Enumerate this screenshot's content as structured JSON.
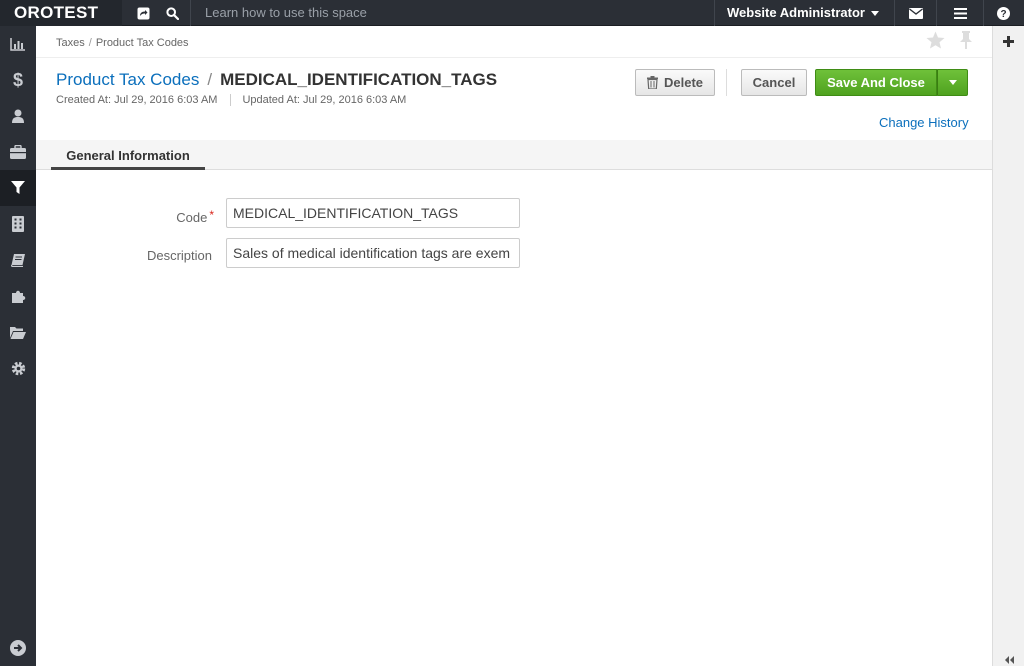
{
  "topbar": {
    "logo": "OROTEST",
    "search_hint": "Learn how to use this space",
    "user_name": "Website Administrator",
    "icons": [
      "share-icon",
      "search-icon",
      "envelope-icon",
      "menu-icon",
      "help-icon"
    ]
  },
  "sidebar": {
    "items": [
      {
        "icon": "dashboard-chart-icon"
      },
      {
        "icon": "dollar-icon"
      },
      {
        "icon": "user-icon"
      },
      {
        "icon": "briefcase-icon"
      },
      {
        "icon": "filter-icon",
        "active": true
      },
      {
        "icon": "building-icon"
      },
      {
        "icon": "book-icon"
      },
      {
        "icon": "puzzle-icon"
      },
      {
        "icon": "folder-open-icon"
      },
      {
        "icon": "gear-icon"
      }
    ],
    "bottom_icon": "arrow-right-circle-icon"
  },
  "breadcrumb": {
    "parent": "Taxes",
    "current": "Product Tax Codes"
  },
  "header": {
    "entity_type": "Product Tax Codes",
    "separator": "/",
    "entity_name": "MEDICAL_IDENTIFICATION_TAGS",
    "created_at": "Created At: Jul 29, 2016 6:03 AM",
    "updated_at": "Updated At: Jul 29, 2016 6:03 AM"
  },
  "actions": {
    "delete_label": "Delete",
    "cancel_label": "Cancel",
    "save_label": "Save And Close",
    "change_history_label": "Change History"
  },
  "tabs": [
    {
      "label": "General Information",
      "active": true
    }
  ],
  "form": {
    "code_label": "Code",
    "code_required_mark": "*",
    "code_value": "MEDICAL_IDENTIFICATION_TAGS",
    "description_label": "Description",
    "description_value": "Sales of medical identification tags are exem"
  },
  "colors": {
    "topbar_bg": "#2b2f36",
    "link": "#0b6fbc",
    "save_button": "#5cb12b",
    "required": "#d9261c"
  }
}
